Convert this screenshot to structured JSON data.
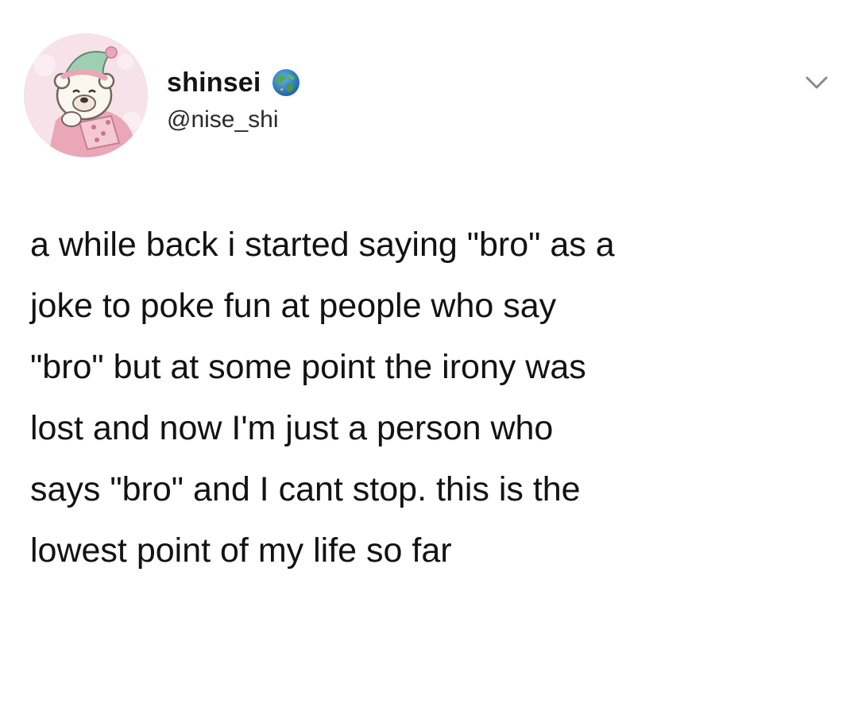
{
  "user": {
    "display_name": "shinsei",
    "handle": "@nise_shi",
    "globe_icon": "globe-icon",
    "menu_icon": "chevron-down-icon"
  },
  "tweet": {
    "lines": [
      "a while back i started saying \"bro\" as a",
      "joke to poke fun at people who say",
      "\"bro\" but at some point the irony was",
      "lost and now I'm just a person who",
      "says \"bro\" and I cant stop. this is the",
      "lowest point of my life so far"
    ]
  },
  "colors": {
    "text": "#121212",
    "handle": "#2b2b2b",
    "chevron": "#8a8a8a",
    "avatar_bg": "#f7e4ea"
  }
}
